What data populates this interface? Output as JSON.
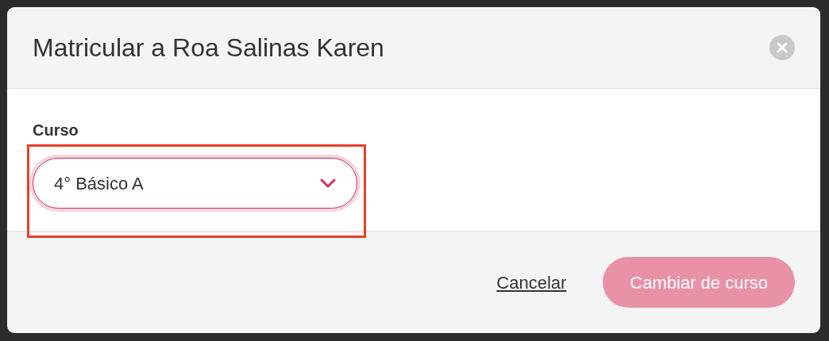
{
  "dialog": {
    "title": "Matricular a Roa Salinas Karen",
    "field": {
      "label": "Curso",
      "value": "4° Básico A",
      "highlighted": true
    },
    "buttons": [
      {
        "kind": "link",
        "label": "Cancelar",
        "disabled": false
      },
      {
        "kind": "primary",
        "label": "Cambiar de curso",
        "disabled": true
      }
    ]
  }
}
